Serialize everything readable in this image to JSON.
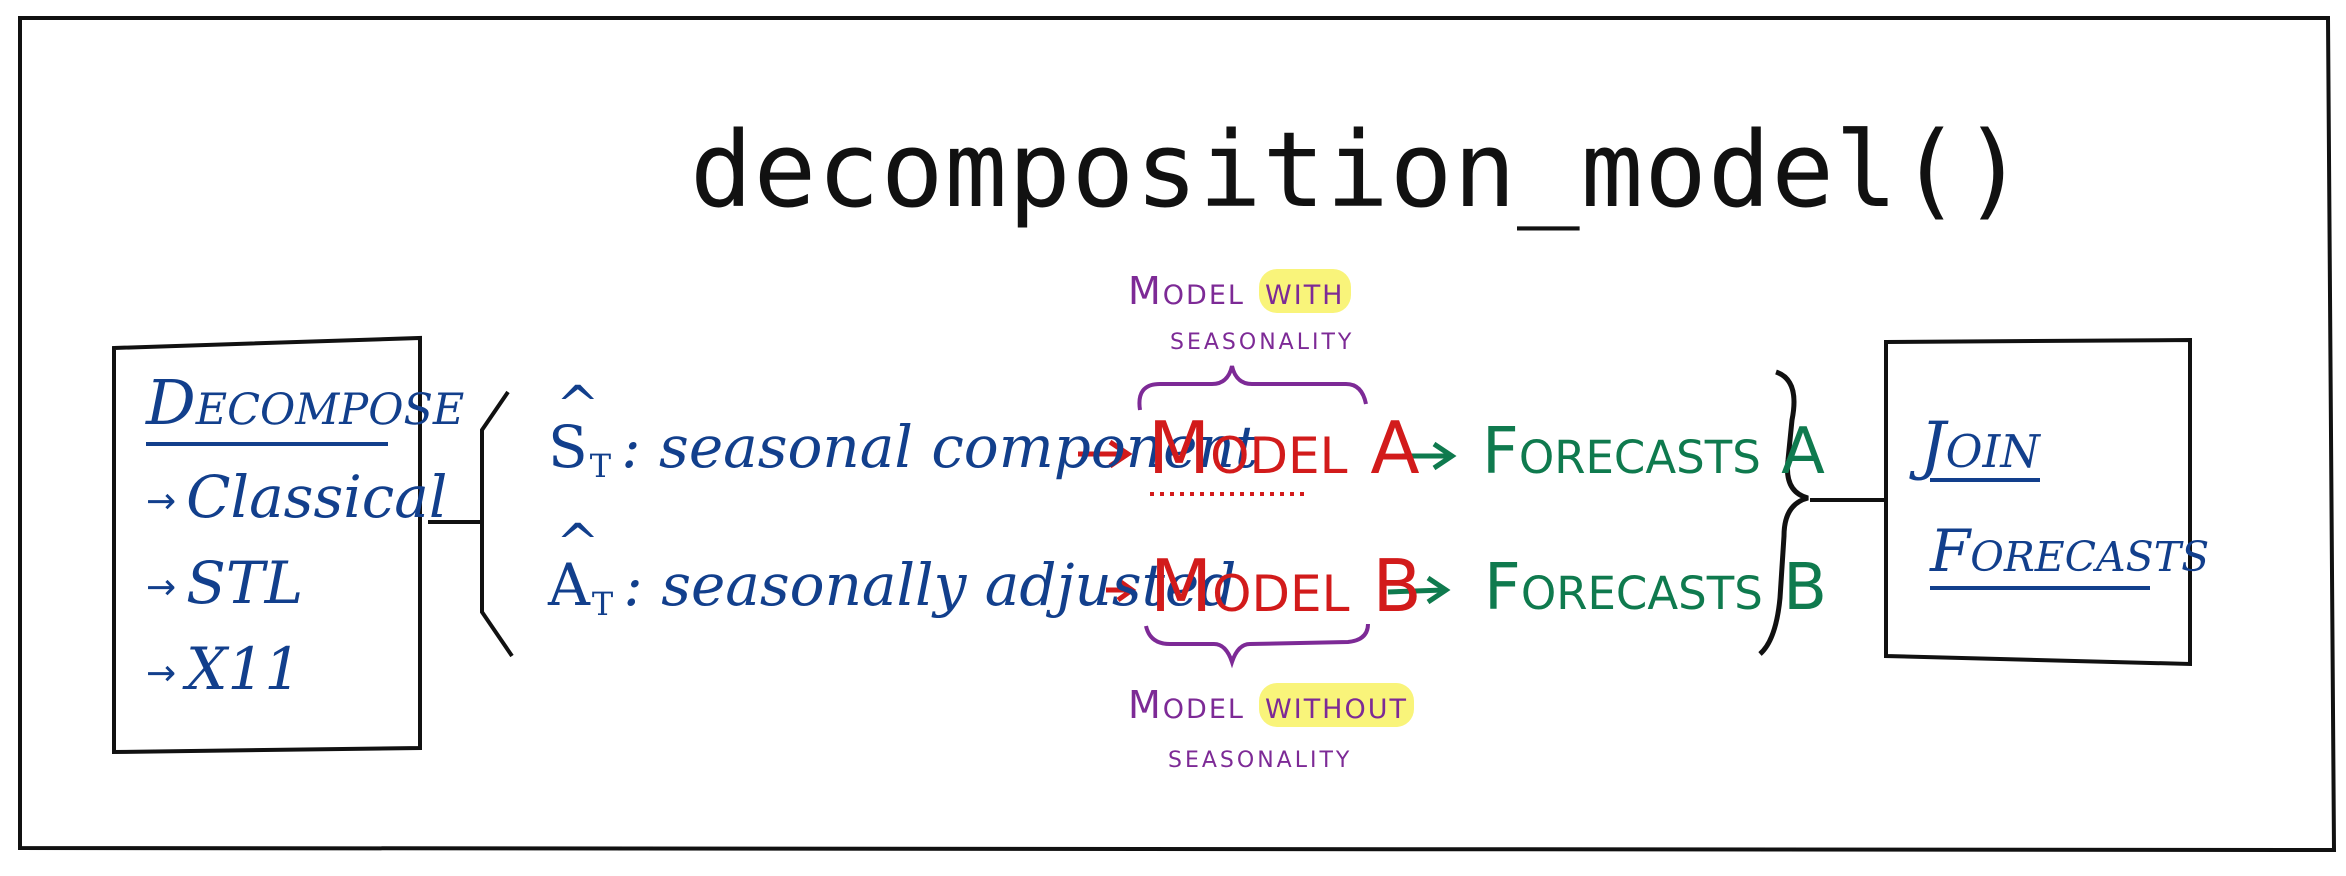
{
  "title": "decomposition_model()",
  "decompose": {
    "heading": "Decompose",
    "methods": [
      "Classical",
      "STL",
      "X11"
    ],
    "arrow_glyph": "→"
  },
  "components": [
    {
      "symbol": "S",
      "subscript": "T",
      "label": ": seasonal component",
      "arrow": "→",
      "model": "Model A",
      "forecast_arrow": "→",
      "forecast": "Forecasts A"
    },
    {
      "symbol": "A",
      "subscript": "T",
      "label": ": seasonally adjusted",
      "arrow": "→",
      "model": "Model B",
      "forecast_arrow": "→",
      "forecast": "Forecasts B"
    }
  ],
  "annotations": {
    "top_line1_a": "Model",
    "top_line1_hl": "with",
    "top_line2": "seasonality",
    "bottom_line1_a": "Model",
    "bottom_line1_hl": "without",
    "bottom_line2": "seasonality"
  },
  "join": {
    "line1": "Join",
    "line2": "Forecasts"
  },
  "colors": {
    "blue": "#123f8c",
    "red": "#d21b1b",
    "green": "#0f7a4e",
    "purple": "#7d2a96",
    "highlight": "#f9f47a",
    "black": "#111111"
  }
}
